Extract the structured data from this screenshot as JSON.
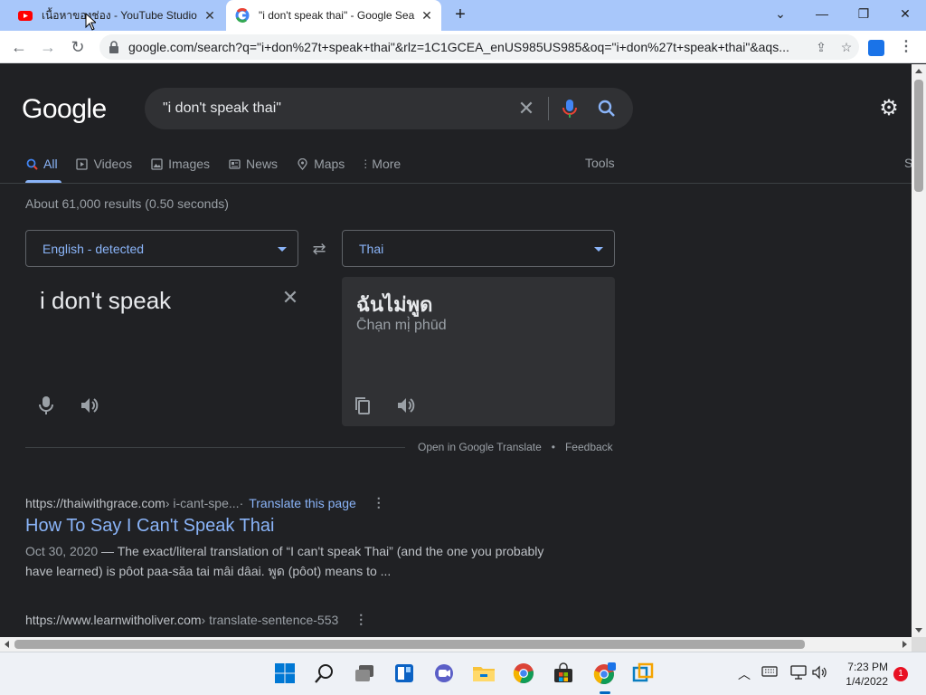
{
  "browser": {
    "tabs": [
      {
        "title": "เนื้อหาของช่อง - YouTube Studio",
        "active": false
      },
      {
        "title": "\"i don't speak thai\" - Google Sea",
        "active": true
      }
    ],
    "new_tab": "+",
    "window": {
      "minimize": "—",
      "maximize": "❐",
      "close": "✕",
      "chevron": "⌄"
    },
    "url": "google.com/search?q=\"i+don%27t+speak+thai\"&rlz=1C1GCEA_enUS985US985&oq=\"i+don%27t+speak+thai\"&aqs..."
  },
  "google": {
    "logo": "Google",
    "query": "\"i don't speak thai\"",
    "tabs": [
      {
        "label": "All",
        "icon": "search-icon",
        "selected": true
      },
      {
        "label": "Videos",
        "icon": "play-icon",
        "selected": false
      },
      {
        "label": "Images",
        "icon": "image-icon",
        "selected": false
      },
      {
        "label": "News",
        "icon": "news-icon",
        "selected": false
      },
      {
        "label": "Maps",
        "icon": "pin-icon",
        "selected": false
      },
      {
        "label": "More",
        "icon": "more-icon",
        "selected": false
      }
    ],
    "tools": "Tools",
    "cut_tab": "S",
    "stats": "About 61,000 results (0.50 seconds)"
  },
  "translate": {
    "source_lang": "English - detected",
    "target_lang": "Thai",
    "source_text": "i don't speak",
    "target_text": "ฉันไม่พูด",
    "transliteration": "C̄hạn mị̀ phūd",
    "open_link": "Open in Google Translate",
    "separator": "•",
    "feedback": "Feedback"
  },
  "results": [
    {
      "site": "https://thaiwithgrace.com",
      "path": " › i-cant-spe...",
      "sep": " · ",
      "translate": "Translate this page",
      "title": "How To Say I Can't Speak Thai",
      "date": "Oct 30, 2020",
      "snippet": " — The exact/literal translation of “I can't speak Thai” (and the one you probably have learned) is pôot paa-săa tai mâi dâai. พูด (pôot) means to ..."
    },
    {
      "site": "https://www.learnwitholiver.com",
      "path": " › translate-sentence-553"
    }
  ],
  "taskbar": {
    "time": "7:23 PM",
    "date": "1/4/2022",
    "notifications": "1"
  },
  "colors": {
    "page_bg": "#202124",
    "link": "#8ab4f8",
    "tab_strip": "#a8c7fa"
  }
}
